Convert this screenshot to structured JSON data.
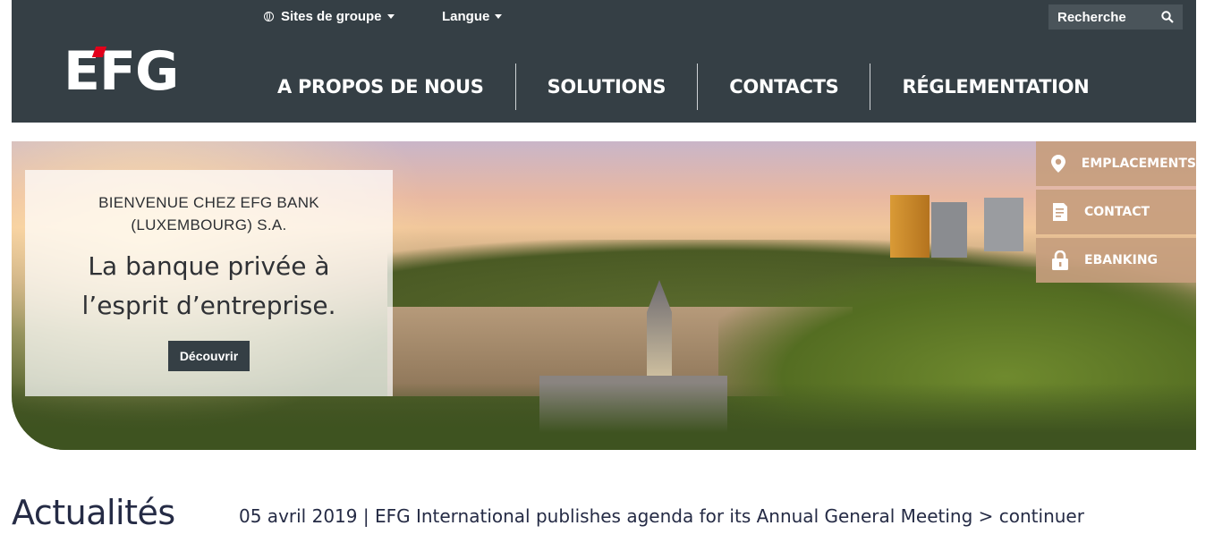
{
  "header": {
    "logo_text": "EFG",
    "topnav": {
      "group_sites": "Sites de groupe",
      "language": "Langue"
    },
    "search": {
      "placeholder": "Recherche"
    },
    "mainnav": [
      "A PROPOS DE NOUS",
      "SOLUTIONS",
      "CONTACTS",
      "RÉGLEMENTATION"
    ]
  },
  "hero": {
    "eyebrow": "BIENVENUE CHEZ EFG BANK (LUXEMBOURG) S.A.",
    "tagline": "La banque privée à l’esprit d’entreprise.",
    "cta": "Découvrir"
  },
  "quicklinks": [
    {
      "label": "EMPLACEMENTS",
      "icon": "map-pin-icon"
    },
    {
      "label": "CONTACT",
      "icon": "document-icon"
    },
    {
      "label": "EBANKING",
      "icon": "lock-icon"
    }
  ],
  "news": {
    "title": "Actualités",
    "date": "05 avril 2019",
    "separator": "|",
    "headline": "EFG International publishes agenda for its Annual General Meeting",
    "more": "> continuer"
  },
  "colors": {
    "header_bg": "#353f45",
    "accent_red": "#e2001a",
    "quicklink_bg": "#c79e7e",
    "news_text": "#252b45"
  }
}
